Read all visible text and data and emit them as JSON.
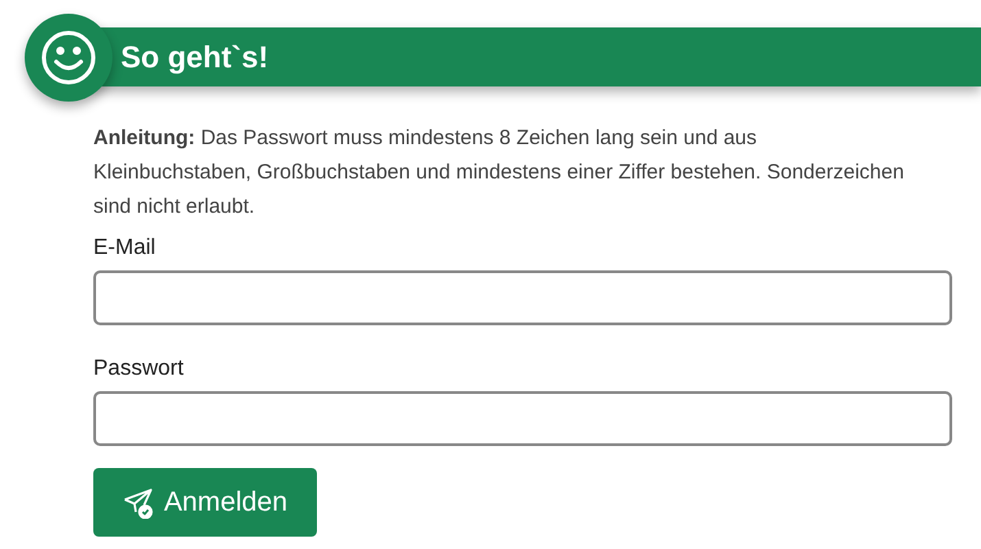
{
  "header": {
    "title": "So geht`s!"
  },
  "instructions": "**Anleitung:** Das Passwort muss mindestens 8 Zeichen lang sein und aus Kleinbuchstaben, Großbuchstaben und mindestens einer Ziffer bestehen. Sonderzeichen sind nicht erlaubt.",
  "fields": [
    {
      "label": "E-Mail"
    },
    {
      "label": "Passwort"
    }
  ],
  "button": {
    "label": "Anmelden"
  }
}
